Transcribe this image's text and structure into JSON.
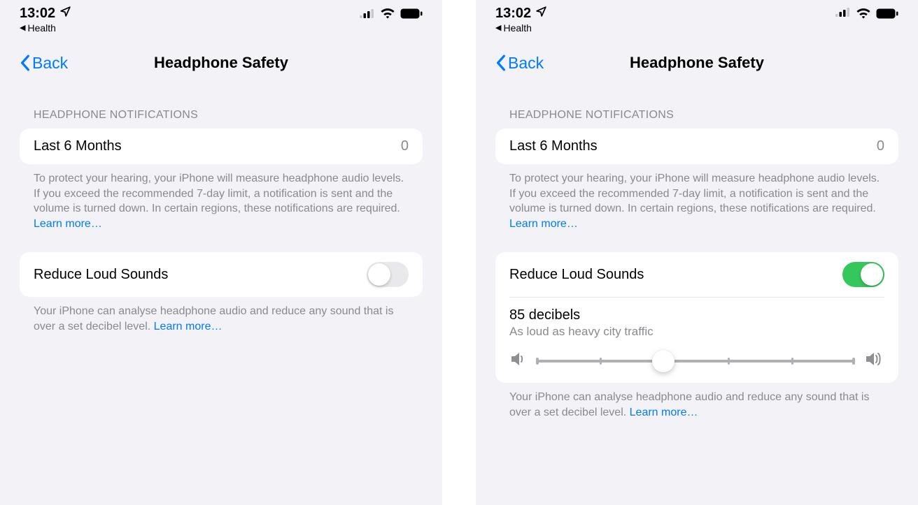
{
  "status": {
    "time": "13:02",
    "breadcrumb_app": "Health"
  },
  "nav": {
    "back_label": "Back",
    "title": "Headphone Safety"
  },
  "notifications": {
    "section_header": "HEADPHONE NOTIFICATIONS",
    "period_label": "Last 6 Months",
    "count": "0",
    "footer": "To protect your hearing, your iPhone will measure headphone audio levels. If you exceed the recommended 7-day limit, a notification is sent and the volume is turned down. In certain regions, these notifications are required. ",
    "learn_more": "Learn more…"
  },
  "reduce": {
    "label": "Reduce Loud Sounds",
    "footer": "Your iPhone can analyse headphone audio and reduce any sound that is over a set decibel level. ",
    "learn_more": "Learn more…",
    "decibel_value": "85 decibels",
    "decibel_compare": "As loud as heavy city traffic",
    "slider_percent": 40
  },
  "colors": {
    "accent": "#007aff",
    "toggle_on": "#34c759"
  }
}
